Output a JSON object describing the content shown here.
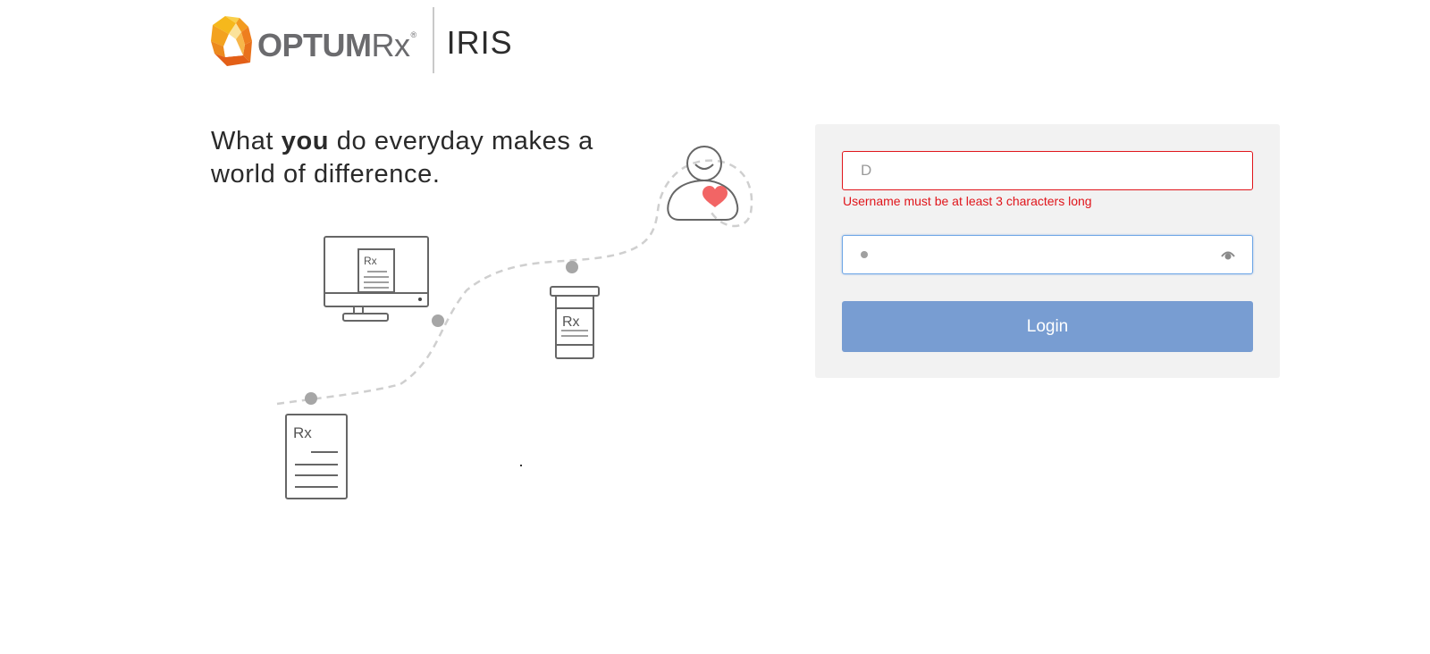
{
  "header": {
    "brand_optum": "OPTUM",
    "brand_rx": "Rx",
    "brand_reg": "®",
    "app_name": "IRIS"
  },
  "tagline": {
    "part1": "What ",
    "emphasis": "you",
    "part2": " do everyday makes a world of difference."
  },
  "illustration": {
    "monitor_label": "Rx",
    "bottle_label": "Rx",
    "document_label": "Rx"
  },
  "login": {
    "username_value": "D",
    "username_error": "Username must be at least 3 characters long",
    "password_masked": true,
    "button_label": "Login"
  },
  "colors": {
    "error": "#e0151b",
    "button": "#789dd2",
    "panel": "#f2f2f2",
    "heart": "#f26565",
    "logo_orange": "#f39a1f",
    "logo_dark_orange": "#e8711c"
  }
}
